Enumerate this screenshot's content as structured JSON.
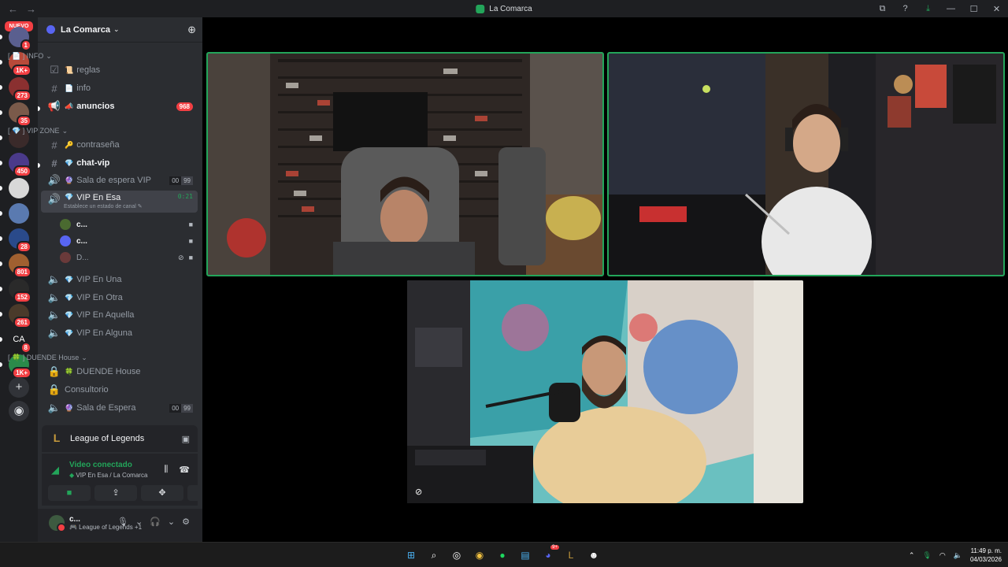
{
  "window": {
    "title": "La Comarca",
    "nav_back": "←",
    "nav_fwd": "→"
  },
  "rail": {
    "new_label": "NUEVO",
    "servers": [
      {
        "name": "server-1",
        "badge": "1",
        "color": "#5a5f8f"
      },
      {
        "name": "server-2",
        "badge": "1K+",
        "color": "#b84a3a"
      },
      {
        "name": "server-3",
        "badge": "273",
        "color": "#8a3030"
      },
      {
        "name": "server-4",
        "badge": "35",
        "color": "#7a5a4a"
      },
      {
        "name": "server-5",
        "badge": "",
        "color": "#3a2a2a"
      },
      {
        "name": "server-6",
        "badge": "450",
        "color": "#4a3a8a"
      },
      {
        "name": "server-7",
        "badge": "",
        "color": "#d8d8d8"
      },
      {
        "name": "server-8",
        "badge": "",
        "color": "#5a7ab0"
      },
      {
        "name": "server-9",
        "badge": "28",
        "color": "#2a4a8a"
      },
      {
        "name": "server-10",
        "badge": "801",
        "color": "#a06030"
      },
      {
        "name": "server-11",
        "badge": "152",
        "color": "#2a2a2a"
      },
      {
        "name": "server-12",
        "badge": "261",
        "color": "#4a3a2a"
      },
      {
        "name": "server-13",
        "badge": "8",
        "color": "#1e1f22",
        "text": "CA"
      },
      {
        "name": "server-14",
        "badge": "1K+",
        "color": "#2a8a4a"
      }
    ],
    "add_label": "+",
    "explore_label": "◉"
  },
  "guild": {
    "name": "La Comarca",
    "chevron": "⌄"
  },
  "categories": {
    "info": "[ 📄 ] INFO",
    "vip": "[ 💎 ] VIP ZONE",
    "duende": "[ 🍀 ] DUENDE House"
  },
  "channels": {
    "reglas": {
      "icon": "☑",
      "emoji": "📜",
      "label": "reglas"
    },
    "info": {
      "icon": "#",
      "emoji": "📄",
      "label": "info"
    },
    "anuncios": {
      "icon": "📢",
      "emoji": "📣",
      "label": "anuncios",
      "count": "968"
    },
    "contrasena": {
      "icon": "#",
      "emoji": "🔑",
      "label": "contraseña"
    },
    "chat_vip": {
      "icon": "#",
      "emoji": "💎",
      "label": "chat-vip"
    },
    "sala_vip": {
      "icon": "🔊",
      "emoji": "🔮",
      "label": "Sala de espera VIP",
      "users_a": "00",
      "users_b": "99"
    },
    "vip_esa": {
      "icon": "🔊",
      "emoji": "💎",
      "label": "VIP En Esa",
      "timer": "0:21",
      "status": "Establece un estado de canal ✎"
    },
    "vip_una": {
      "icon": "🔈",
      "emoji": "💎",
      "label": "VIP En Una"
    },
    "vip_otra": {
      "icon": "🔈",
      "emoji": "💎",
      "label": "VIP En Otra"
    },
    "vip_aquella": {
      "icon": "🔈",
      "emoji": "💎",
      "label": "VIP En Aquella"
    },
    "vip_alguna": {
      "icon": "🔈",
      "emoji": "💎",
      "label": "VIP En Alguna"
    },
    "duende_house": {
      "icon": "🔒",
      "emoji": "🍀",
      "label": "DUENDE House"
    },
    "consultorio": {
      "icon": "🔒",
      "emoji": "",
      "label": "Consultorio"
    },
    "sala_espera": {
      "icon": "🔈",
      "emoji": "🔮",
      "label": "Sala de Espera",
      "users_a": "00",
      "users_b": "99"
    }
  },
  "voice_users": [
    {
      "name": "c...",
      "color": "#4a6a30"
    },
    {
      "name": "c...",
      "color": "#5865f2"
    },
    {
      "name": "D...",
      "color": "#6a3a3a"
    }
  ],
  "activity": {
    "name": "League of Legends",
    "logo": "L"
  },
  "voice": {
    "status": "Video conectado",
    "channel": "VIP En Esa",
    "server": "La Comarca"
  },
  "user": {
    "name": "c...",
    "status": "🎮 League of Legends +1"
  },
  "taskbar": {
    "time": "11:49 p. m.",
    "date": "04/03/2026"
  },
  "colors": {
    "speaking": "#23a55a",
    "badge": "#f23f43",
    "blurple": "#5865f2"
  }
}
